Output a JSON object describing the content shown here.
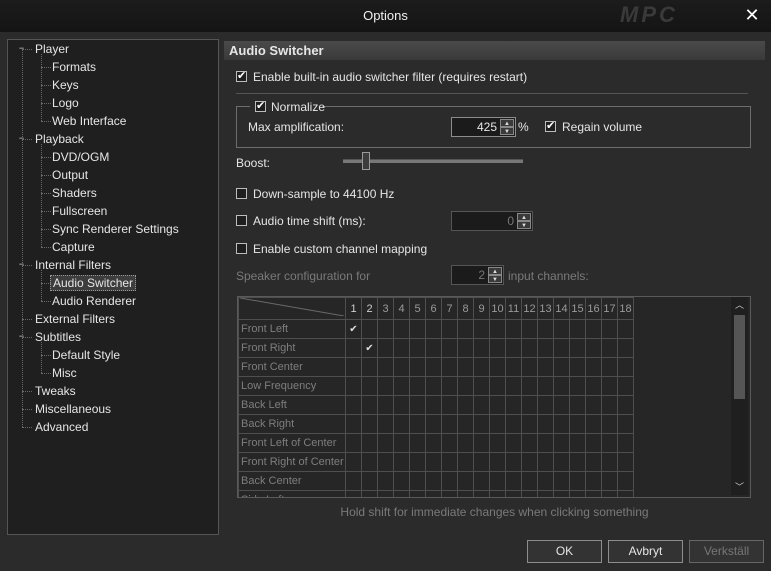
{
  "window": {
    "title": "Options",
    "logo_text": "MPC"
  },
  "tree": [
    {
      "label": "Player",
      "level": 0,
      "expander": "minus"
    },
    {
      "label": "Formats",
      "level": 1
    },
    {
      "label": "Keys",
      "level": 1
    },
    {
      "label": "Logo",
      "level": 1
    },
    {
      "label": "Web Interface",
      "level": 1
    },
    {
      "label": "Playback",
      "level": 0,
      "expander": "minus"
    },
    {
      "label": "DVD/OGM",
      "level": 1
    },
    {
      "label": "Output",
      "level": 1
    },
    {
      "label": "Shaders",
      "level": 1
    },
    {
      "label": "Fullscreen",
      "level": 1
    },
    {
      "label": "Sync Renderer Settings",
      "level": 1
    },
    {
      "label": "Capture",
      "level": 1
    },
    {
      "label": "Internal Filters",
      "level": 0,
      "expander": "minus"
    },
    {
      "label": "Audio Switcher",
      "level": 1,
      "selected": true
    },
    {
      "label": "Audio Renderer",
      "level": 1
    },
    {
      "label": "External Filters",
      "level": 0
    },
    {
      "label": "Subtitles",
      "level": 0,
      "expander": "minus"
    },
    {
      "label": "Default Style",
      "level": 1
    },
    {
      "label": "Misc",
      "level": 1
    },
    {
      "label": "Tweaks",
      "level": 0
    },
    {
      "label": "Miscellaneous",
      "level": 0
    },
    {
      "label": "Advanced",
      "level": 0
    }
  ],
  "page": {
    "header": "Audio Switcher",
    "enable_switcher": {
      "label": "Enable built-in audio switcher filter (requires restart)",
      "checked": true
    },
    "normalize": {
      "label": "Normalize",
      "checked": true
    },
    "max_amplification": {
      "label": "Max amplification:",
      "value": "425",
      "unit": "%"
    },
    "regain_volume": {
      "label": "Regain volume",
      "checked": true
    },
    "boost": {
      "label": "Boost:",
      "level": 0.13
    },
    "downsample": {
      "label": "Down-sample to 44100 Hz",
      "checked": false
    },
    "time_shift": {
      "label": "Audio time shift (ms):",
      "checked": false,
      "value": "0"
    },
    "custom_mapping": {
      "label": "Enable custom channel mapping",
      "checked": false
    },
    "speaker_config": {
      "label": "Speaker configuration for",
      "value": "2",
      "suffix": "input channels:"
    },
    "channel_grid": {
      "columns": [
        "1",
        "2",
        "3",
        "4",
        "5",
        "6",
        "7",
        "8",
        "9",
        "10",
        "11",
        "12",
        "13",
        "14",
        "15",
        "16",
        "17",
        "18"
      ],
      "active_columns": 2,
      "rows": [
        "Front Left",
        "Front Right",
        "Front Center",
        "Low Frequency",
        "Back Left",
        "Back Right",
        "Front Left of Center",
        "Front Right of Center",
        "Back Center",
        "Side Left"
      ],
      "checks": [
        [
          0,
          0
        ],
        [
          1,
          1
        ]
      ],
      "check_glyph": "✔"
    },
    "hint": "Hold shift for immediate changes when clicking something"
  },
  "buttons": {
    "ok": "OK",
    "cancel": "Avbryt",
    "apply": "Verkställ"
  }
}
